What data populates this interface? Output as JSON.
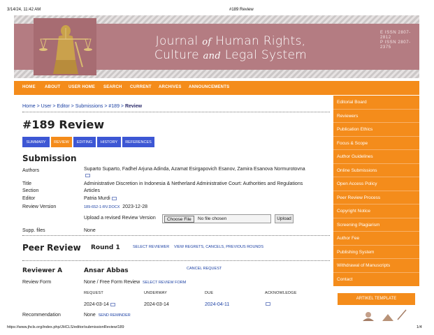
{
  "print": {
    "timestamp": "3/14/24, 11:42 AM",
    "page_title": "#189 Review",
    "url": "https://www.jhcls.org/index.php/JHCLS/editor/submissionReview/189",
    "page_number": "1/4"
  },
  "banner": {
    "title_part1": "Journal",
    "title_of": "of",
    "title_part2": "Human Rights,",
    "title_line2a": "Culture",
    "title_and": "and",
    "title_line2b": "Legal System",
    "issn_e": "E ISSN 2807-2812",
    "issn_p": "P ISSN 2807-2375"
  },
  "nav": [
    "HOME",
    "ABOUT",
    "USER HOME",
    "SEARCH",
    "CURRENT",
    "ARCHIVES",
    "ANNOUNCEMENTS"
  ],
  "breadcrumb": {
    "home": "Home",
    "sep": " > ",
    "user": "User",
    "editor": "Editor",
    "submissions": "Submissions",
    "id": "#189",
    "current": "Review"
  },
  "page_heading": "#189 Review",
  "tabs": [
    "SUMMARY",
    "REVIEW",
    "EDITING",
    "HISTORY",
    "REFERENCES"
  ],
  "submission": {
    "heading": "Submission",
    "authors_label": "Authors",
    "authors": "Suparto Suparto, Fadhel Arjuna Adinda, Azamat Esirgapovich Esanov, Zamira Esanova Normurotovna",
    "title_label": "Title",
    "title": "Administrative Discretion in Indonesia & Netherland Administrative Court: Authorities and Regulations",
    "section_label": "Section",
    "section": "Articles",
    "editor_label": "Editor",
    "editor": "Patria Murdi",
    "review_version_label": "Review Version",
    "review_file": "189-652-1-RV.DOCX",
    "review_date": "2023-12-28",
    "upload_prompt": "Upload a revised Review Version",
    "choose_file": "Choose File",
    "no_file": "No file chosen",
    "upload_button": "Upload",
    "supp_label": "Supp. files",
    "supp_value": "None"
  },
  "peer_review": {
    "heading": "Peer Review",
    "round": "Round 1",
    "select_reviewer": "SELECT REVIEWER",
    "view_regrets": "VIEW REGRETS, CANCELS, PREVIOUS ROUNDS"
  },
  "reviewer": {
    "label": "Reviewer A",
    "name": "Ansar Abbas",
    "cancel": "CANCEL REQUEST",
    "form_label": "Review Form",
    "form_value": "None / Free Form Review",
    "select_form": "SELECT REVIEW FORM",
    "col_request": "REQUEST",
    "col_underway": "UNDERWAY",
    "col_due": "DUE",
    "col_ack": "ACKNOWLEDGE",
    "request_date": "2024-03-14",
    "underway_date": "2024-03-14",
    "due_date": "2024-04-11",
    "recommendation_label": "Recommendation",
    "recommendation_value": "None",
    "send_reminder": "SEND REMINDER"
  },
  "sidebar": {
    "items": [
      "Editorial Board",
      "Reviewers",
      "Publication Ethics",
      "Focus & Scope",
      "Author Guidelines",
      "Online Submissions",
      "Open Access Policy",
      "Peer Review Process",
      "Copyright Notice",
      "Screening Plagiarism",
      "Author Fee",
      "Publishing System",
      "Withdrawal of Manuscripts",
      "Contact"
    ],
    "template": "ARTIKEL TEMPLATE"
  },
  "colors": {
    "accent": "#f48c1b",
    "banner": "#b47c82",
    "tab_blue": "#3d57d4",
    "link": "#1a3fa3"
  }
}
